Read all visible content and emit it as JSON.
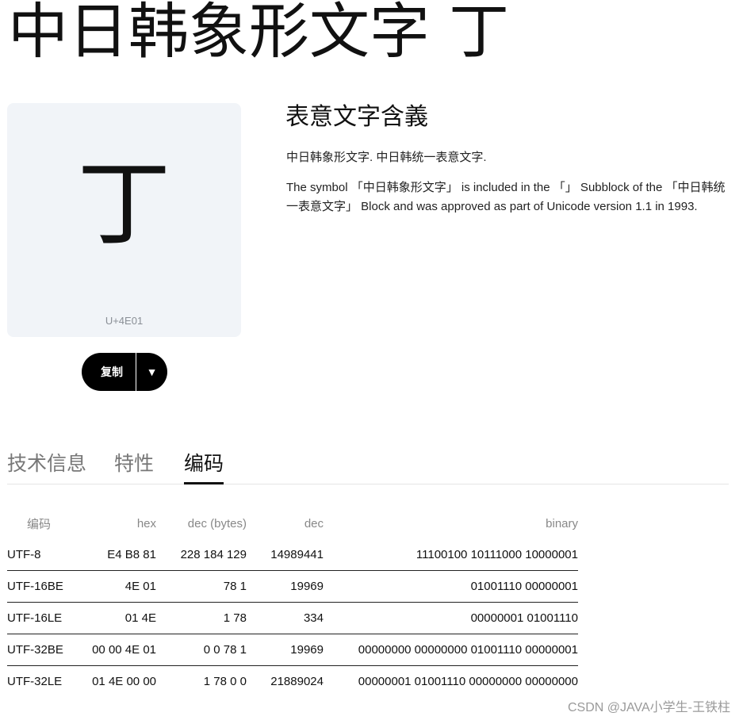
{
  "page": {
    "title": "中日韩象形文字 丁"
  },
  "glyph_card": {
    "character": "丁",
    "codepoint": "U+4E01"
  },
  "copy_button": {
    "label": "复制",
    "menu_glyph": "▼"
  },
  "meaning": {
    "title": "表意文字含義",
    "short": "中日韩象形文字. 中日韩统一表意文字.",
    "description": "The symbol 「中日韩象形文字」 is included in the 「」 Subblock of the 「中日韩统一表意文字」 Block and was approved as part of Unicode version 1.1 in 1993."
  },
  "tabs": [
    {
      "label": "技术信息",
      "active": false
    },
    {
      "label": "特性",
      "active": false
    },
    {
      "label": "编码",
      "active": true
    }
  ],
  "encoding_table": {
    "headers": {
      "encoding": "编码",
      "hex": "hex",
      "dec_bytes": "dec (bytes)",
      "dec": "dec",
      "binary": "binary"
    },
    "rows": [
      {
        "encoding": "UTF-8",
        "hex": "E4 B8 81",
        "dec_bytes": "228 184 129",
        "dec": "14989441",
        "binary": "11100100 10111000 10000001"
      },
      {
        "encoding": "UTF-16BE",
        "hex": "4E 01",
        "dec_bytes": "78 1",
        "dec": "19969",
        "binary": "01001110 00000001"
      },
      {
        "encoding": "UTF-16LE",
        "hex": "01 4E",
        "dec_bytes": "1 78",
        "dec": "334",
        "binary": "00000001 01001110"
      },
      {
        "encoding": "UTF-32BE",
        "hex": "00 00 4E 01",
        "dec_bytes": "0 0 78 1",
        "dec": "19969",
        "binary": "00000000 00000000 01001110 00000001"
      },
      {
        "encoding": "UTF-32LE",
        "hex": "01 4E 00 00",
        "dec_bytes": "1 78 0 0",
        "dec": "21889024",
        "binary": "00000001 01001110 00000000 00000000"
      }
    ]
  },
  "watermark": "CSDN @JAVA小学生-王铁柱"
}
